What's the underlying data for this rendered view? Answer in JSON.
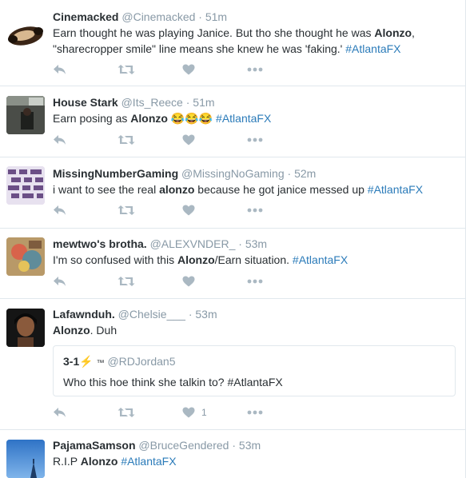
{
  "tweets": [
    {
      "fullname": "Cinemacked",
      "username": "@Cinemacked",
      "dot": "·",
      "time": "51m",
      "parts": [
        {
          "t": "Earn thought he was playing Janice. But tho she thought he was "
        },
        {
          "t": "Alonzo",
          "b": true
        },
        {
          "t": ", \"sharecropper smile\" line means she knew he was 'faking.' "
        },
        {
          "t": "#AtlantaFX",
          "h": true
        }
      ],
      "like_count": ""
    },
    {
      "fullname": "House Stark",
      "username": "@Its_Reece",
      "dot": "·",
      "time": "51m",
      "parts": [
        {
          "t": "Earn posing as "
        },
        {
          "t": "Alonzo",
          "b": true
        },
        {
          "t": " 😂😂😂 "
        },
        {
          "t": "#AtlantaFX",
          "h": true
        }
      ],
      "like_count": ""
    },
    {
      "fullname": "MissingNumberGaming",
      "username": "@MissingNoGaming",
      "dot": "·",
      "time": "52m",
      "parts": [
        {
          "t": "i want to see the real "
        },
        {
          "t": "alonzo",
          "b": true
        },
        {
          "t": " because he got janice messed up "
        },
        {
          "t": "#AtlantaFX",
          "h": true
        }
      ],
      "like_count": ""
    },
    {
      "fullname": "mewtwo's brotha.",
      "username": "@ALEXVNDER_",
      "dot": "·",
      "time": "53m",
      "parts": [
        {
          "t": "I'm so confused with this "
        },
        {
          "t": "Alonzo",
          "b": true
        },
        {
          "t": "/Earn situation. "
        },
        {
          "t": "#AtlantaFX",
          "h": true
        }
      ],
      "like_count": ""
    },
    {
      "fullname": "Lafawnduh.",
      "username": "@Chelsie___",
      "dot": "·",
      "time": "53m",
      "parts": [
        {
          "t": "Alonzo",
          "b": true
        },
        {
          "t": ". Duh"
        }
      ],
      "quote": {
        "name": "3-1",
        "bolt": "⚡",
        "tm": "™",
        "username": "@RDJordan5",
        "text": "Who this hoe think she talkin to? #AtlantaFX"
      },
      "like_count": "1"
    },
    {
      "fullname": "PajamaSamson",
      "username": "@BruceGendered",
      "dot": "·",
      "time": "53m",
      "parts": [
        {
          "t": "R.I.P "
        },
        {
          "t": "Alonzo",
          "b": true
        },
        {
          "t": " "
        },
        {
          "t": "#AtlantaFX",
          "h": true
        }
      ],
      "like_count": ""
    }
  ],
  "icons": {
    "reply": "reply-icon",
    "retweet": "retweet-icon",
    "like": "heart-icon",
    "more": "more-icon"
  },
  "colors": {
    "text": "#292f33",
    "muted": "#8899a6",
    "hashtag": "#2b7bb9",
    "action_icon": "#aab8c2",
    "divider": "#e1e8ed"
  }
}
